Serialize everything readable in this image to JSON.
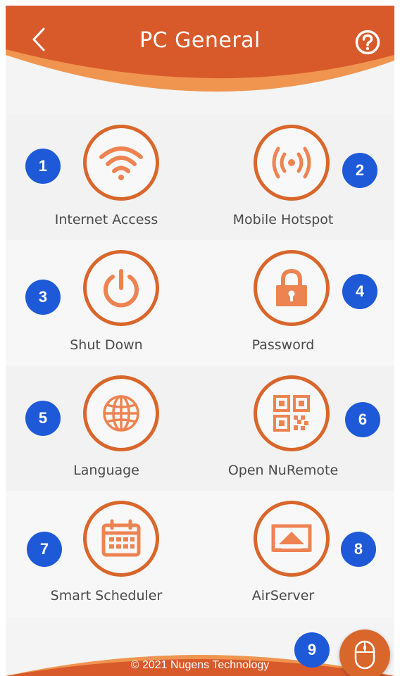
{
  "header": {
    "title": "PC General",
    "back_icon": "chevron-left-icon",
    "help_icon": "help-circle-icon"
  },
  "tiles": [
    {
      "label": "Internet Access",
      "icon": "wifi-icon",
      "badge": "1"
    },
    {
      "label": "Mobile Hotspot",
      "icon": "hotspot-icon",
      "badge": "2"
    },
    {
      "label": "Shut Down",
      "icon": "power-icon",
      "badge": "3"
    },
    {
      "label": "Password",
      "icon": "lock-icon",
      "badge": "4"
    },
    {
      "label": "Language",
      "icon": "globe-icon",
      "badge": "5"
    },
    {
      "label": "Open NuRemote",
      "icon": "qr-code-icon",
      "badge": "6"
    },
    {
      "label": "Smart Scheduler",
      "icon": "calendar-icon",
      "badge": "7"
    },
    {
      "label": "AirServer",
      "icon": "airplay-icon",
      "badge": "8"
    }
  ],
  "fab": {
    "icon": "mouse-icon",
    "badge": "9"
  },
  "footer": {
    "copyright": "© 2021 Nugens Technology"
  },
  "colors": {
    "accent": "#d9662b",
    "accent_light": "#f08a4b",
    "badge": "#1e5ad8",
    "background": "#f4f4f4"
  }
}
